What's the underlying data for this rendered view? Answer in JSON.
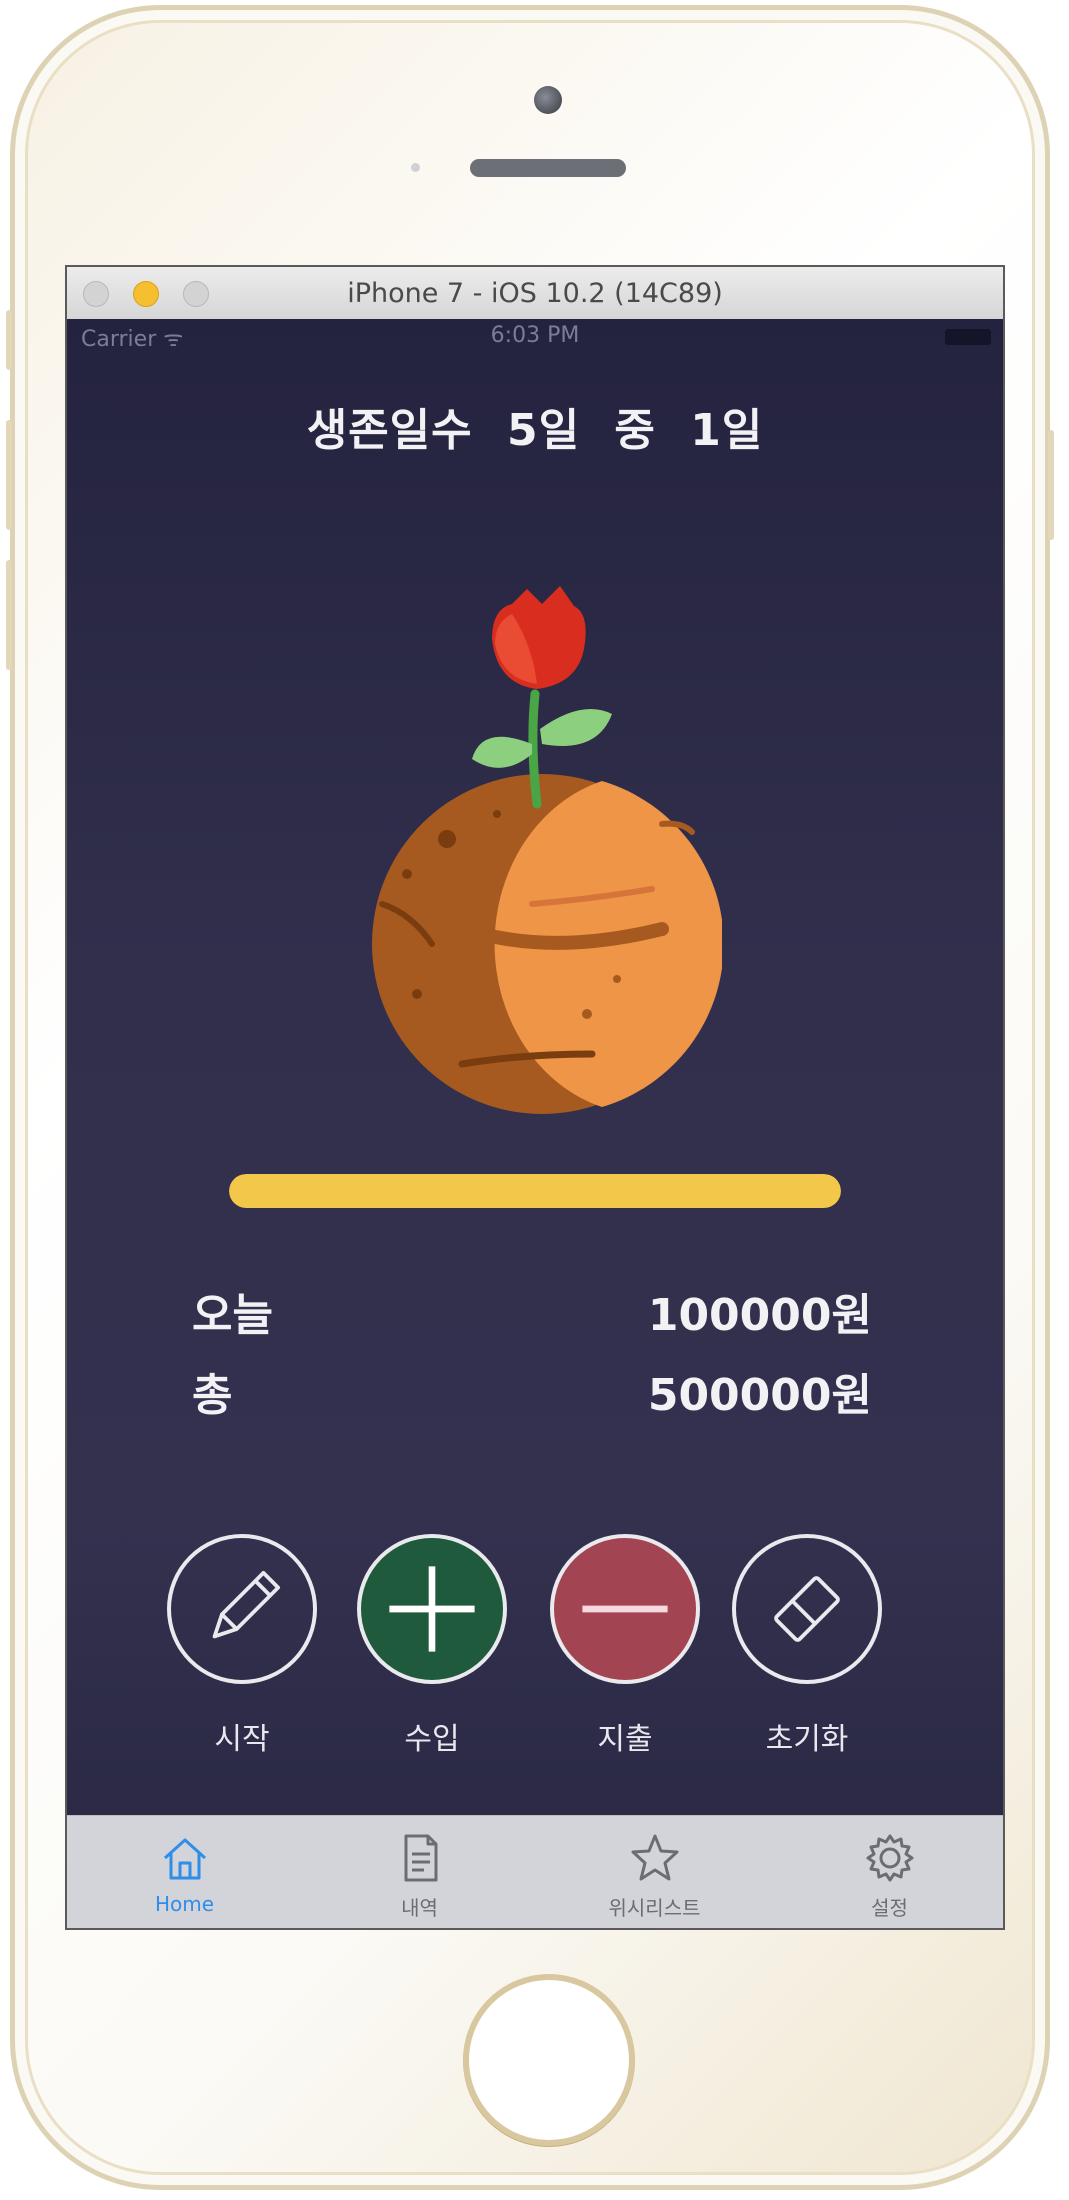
{
  "simulator": {
    "title": "iPhone 7 - iOS 10.2 (14C89)"
  },
  "status_bar": {
    "carrier": "Carrier ᯤ",
    "time": "6:03 PM"
  },
  "header": {
    "survival_label": "생존일수",
    "days_text": "5일 중",
    "current_day": "1일"
  },
  "progress": {
    "fraction": 1.0,
    "color": "#f3c74a"
  },
  "balance": {
    "today_label": "오늘",
    "today_amount": "100000원",
    "total_label": "총",
    "total_amount": "500000원"
  },
  "actions": [
    {
      "label": "시작",
      "icon": "pencil-icon"
    },
    {
      "label": "수입",
      "icon": "plus-icon",
      "color": "#1f5a3d"
    },
    {
      "label": "지출",
      "icon": "minus-icon",
      "color": "#a34452"
    },
    {
      "label": "초기화",
      "icon": "eraser-icon"
    }
  ],
  "tab_bar": {
    "items": [
      {
        "label": "Home",
        "icon": "home-icon",
        "active": true
      },
      {
        "label": "내역",
        "icon": "document-icon",
        "active": false
      },
      {
        "label": "위시리스트",
        "icon": "star-icon",
        "active": false
      },
      {
        "label": "설정",
        "icon": "gear-icon",
        "active": false
      }
    ],
    "active_color": "#2e8ee8"
  }
}
